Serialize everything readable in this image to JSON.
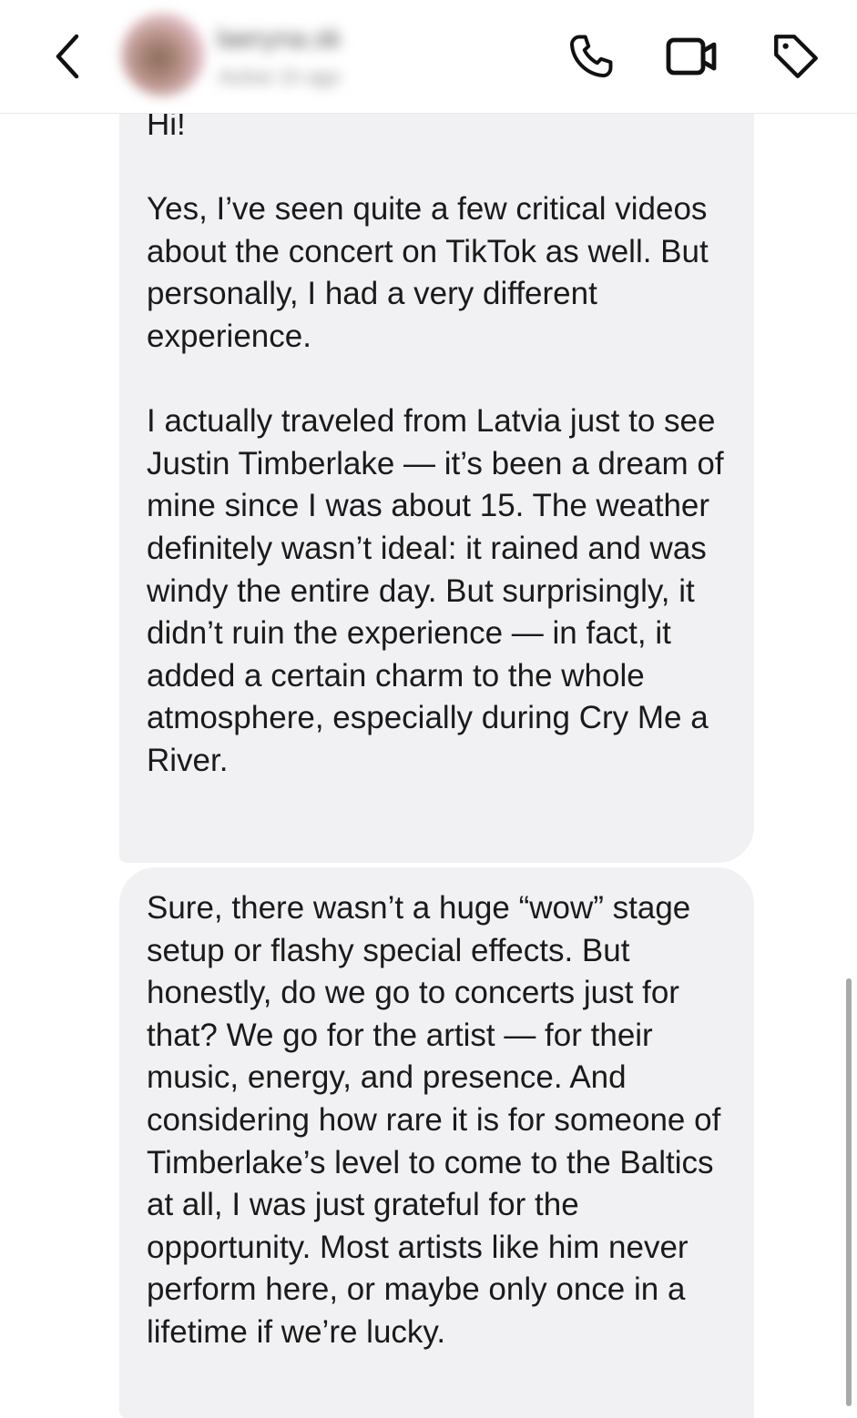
{
  "header": {
    "contact_name": "laeryna.sk",
    "contact_status": "Active 1h ago"
  },
  "messages": [
    {
      "text": "Hi!\n\nYes, I’ve seen quite a few critical videos about the concert on TikTok as well. But personally, I had a very different experience.\n\nI actually traveled from Latvia just to see Justin Timberlake — it’s been a dream of mine since I was about 15. The weather definitely wasn’t ideal: it rained and was windy the entire day. But surprisingly, it didn’t ruin the experience — in fact, it added a certain charm to the whole atmosphere, especially during Cry Me a River."
    },
    {
      "text": "Sure, there wasn’t a huge “wow” stage setup or flashy special effects. But honestly, do we go to concerts just for that? We go for the artist — for their music, energy, and presence. And considering how rare it is for someone of Timberlake’s level to come to the Baltics at all, I was just grateful for the opportunity. Most artists like him never perform here, or maybe only once in a lifetime if we’re lucky."
    }
  ],
  "icons": {
    "back": "chevron-left-icon",
    "call": "phone-icon",
    "video": "video-camera-icon",
    "tag": "tag-icon"
  },
  "colors": {
    "bubble_background": "#f1f1f3",
    "text": "#1a1a1a",
    "header_background": "#ffffff"
  }
}
